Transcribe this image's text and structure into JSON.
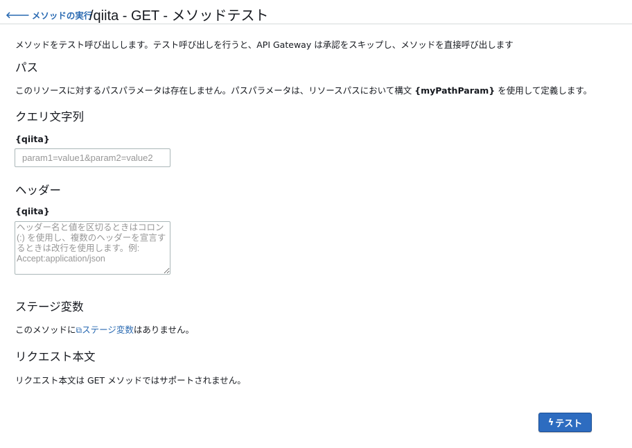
{
  "header": {
    "back_label": "メソッドの実行",
    "title": "/qiita - GET - メソッドテスト"
  },
  "intro": "メソッドをテスト呼び出しします。テスト呼び出しを行うと、API Gateway は承認をスキップし、メソッドを直接呼び出します",
  "path": {
    "heading": "パス",
    "text_before": "このリソースに対するパスパラメータは存在しません。パスパラメータは、リソースパスにおいて構文 ",
    "text_bold": "{myPathParam}",
    "text_after": " を使用して定義します。"
  },
  "query": {
    "heading": "クエリ文字列",
    "label": "{qiita}",
    "placeholder": "param1=value1&param2=value2",
    "value": ""
  },
  "headers": {
    "heading": "ヘッダー",
    "label": "{qiita}",
    "placeholder": "ヘッダー名と値を区切るときはコロン (:) を使用し、複数のヘッダーを宣言するときは改行を使用します。例: Accept:application/json",
    "value": ""
  },
  "stage_vars": {
    "heading": "ステージ変数",
    "text_before": "このメソッドに",
    "link_label": "ステージ変数",
    "text_after": "はありません。"
  },
  "request_body": {
    "heading": "リクエスト本文",
    "text": "リクエスト本文は GET メソッドではサポートされません。"
  },
  "actions": {
    "test_label": "テスト"
  },
  "colors": {
    "link": "#2a6ab2",
    "button": "#2d6cc0"
  }
}
